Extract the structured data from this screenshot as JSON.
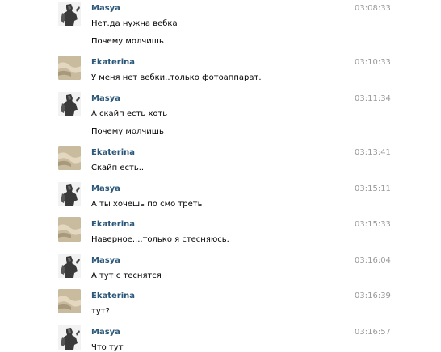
{
  "messages": [
    {
      "author": "Masya",
      "time": "03:08:33",
      "lines": [
        "Нет.да нужна вебка",
        "Почему молчишь"
      ]
    },
    {
      "author": "Ekaterina",
      "time": "03:10:33",
      "lines": [
        "У меня нет вебки..только фотоаппарат."
      ]
    },
    {
      "author": "Masya",
      "time": "03:11:34",
      "lines": [
        "А скайп есть хоть",
        "Почему молчишь"
      ]
    },
    {
      "author": "Ekaterina",
      "time": "03:13:41",
      "lines": [
        "Скайп есть.."
      ]
    },
    {
      "author": "Masya",
      "time": "03:15:11",
      "lines": [
        "А ты хочешь по смо треть"
      ]
    },
    {
      "author": "Ekaterina",
      "time": "03:15:33",
      "lines": [
        "Наверное....только я стесняюсь."
      ]
    },
    {
      "author": "Masya",
      "time": "03:16:04",
      "lines": [
        "А тут с теснятся"
      ]
    },
    {
      "author": "Ekaterina",
      "time": "03:16:39",
      "lines": [
        "тут?"
      ]
    },
    {
      "author": "Masya",
      "time": "03:16:57",
      "lines": [
        "Что тут"
      ]
    }
  ],
  "colors": {
    "author": "#2b587a",
    "time": "#999999",
    "text": "#000000"
  },
  "icons": {
    "masya_avatar": "armored-warrior-avatar-icon",
    "ekaterina_avatar": "hands-photo-avatar-icon"
  }
}
